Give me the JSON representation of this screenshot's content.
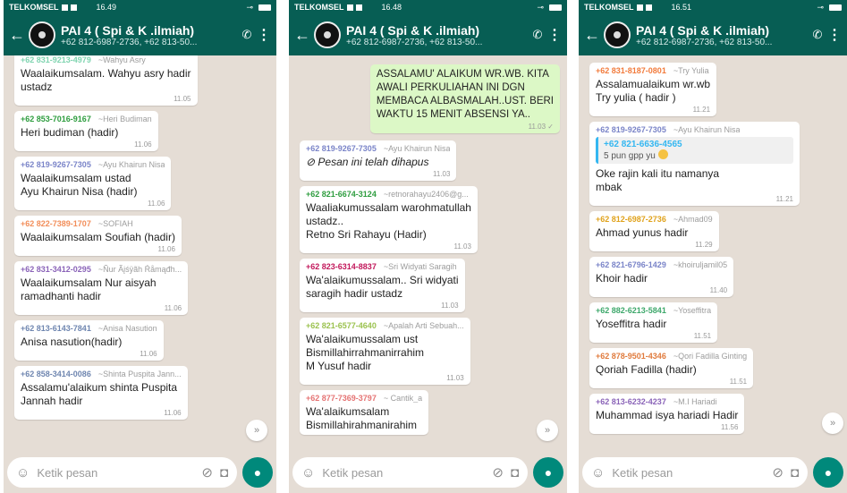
{
  "panels": [
    {
      "status": {
        "carrier": "TELKOMSEL",
        "time": "16.49"
      },
      "header": {
        "title": "PAI 4 ( Spi & K .ilmiah)",
        "subtitle": "+62 812-6987-2736, +62 813-50..."
      },
      "messages": [
        {
          "number": "+62 831-9213-4979",
          "name": "~Wahyu Asry",
          "color": "#7fd4b0",
          "text": "Waalaikumsalam. Wahyu asry hadir\nustadz",
          "time": "11.05"
        },
        {
          "number": "+62 853-7016-9167",
          "name": "~Heri Budiman",
          "color": "#2e9d3f",
          "text": "Heri budiman (hadir)",
          "time": "11.06"
        },
        {
          "number": "+62 819-9267-7305",
          "name": "~Ayu Khairun Nisa",
          "color": "#7a84c8",
          "text": "Waalaikumsalam ustad\nAyu Khairun Nisa (hadir)",
          "time": "11.06"
        },
        {
          "number": "+62 822-7389-1707",
          "name": "~SOFIAH",
          "color": "#f28e5a",
          "text": "Waalaikumsalam Soufiah (hadir)",
          "time": "11.06"
        },
        {
          "number": "+62 831-3412-0295",
          "name": "~Ñur Ãįśÿãh Ŕåmąđh...",
          "color": "#8a63b8",
          "text": "Waalaikumsalam Nur aisyah\nramadhanti hadir",
          "time": "11.06"
        },
        {
          "number": "+62 813-6143-7841",
          "name": "~Anisa Nasution",
          "color": "#6f86b0",
          "text": "Anisa nasution(hadir)",
          "time": "11.06"
        },
        {
          "number": "+62 858-3414-0086",
          "name": "~Shinta Puspita Jann...",
          "color": "#6f86b0",
          "text": "Assalamu'alaikum shinta Puspita\nJannah hadir",
          "time": "11.06"
        }
      ],
      "input": {
        "placeholder": "Ketik pesan"
      }
    },
    {
      "status": {
        "carrier": "TELKOMSEL",
        "time": "16.48"
      },
      "header": {
        "title": "PAI 4 ( Spi & K .ilmiah)",
        "subtitle": "+62 812-6987-2736, +62 813-50..."
      },
      "outgoing": {
        "text": "ASSALAMU' ALAIKUM WR.WB. KITA\nAWALI PERKULIAHAN INI DGN\nMEMBACA ALBASMALAH..UST. BERI\nWAKTU 15 MENIT ABSENSI YA..",
        "time": "11.03 ✓"
      },
      "messages": [
        {
          "number": "+62 819-9267-7305",
          "name": "~Ayu Khairun Nisa",
          "color": "#7a84c8",
          "text": "Pesan ini telah dihapus",
          "time": "11.03",
          "deleted": true
        },
        {
          "number": "+62 821-6674-3124",
          "name": "~retnorahayu2406@g...",
          "color": "#2e9d3f",
          "text": "Waaliakumussalam warohmatullah\nustadz..\nRetno Sri Rahayu (Hadir)",
          "time": "11.03"
        },
        {
          "number": "+62 823-6314-8837",
          "name": "~Sri Widyati Saragih",
          "color": "#c2185b",
          "text": "Wa'alaikumussalam.. Sri widyati\nsaragih hadir ustadz",
          "time": "11.03"
        },
        {
          "number": "+62 821-6577-4640",
          "name": "~Apalah Arti Sebuah...",
          "color": "#9bc24f",
          "text": "Wa'alaikumussalam ust\nBismillahirrahmanirrahim\nM Yusuf hadir",
          "time": "11.03"
        },
        {
          "number": "+62 877-7369-3797",
          "name": "~ Cantik_a",
          "color": "#e57373",
          "text": "Wa'alaikumsalam\nBismillahirahmanirahim",
          "time": ""
        }
      ],
      "input": {
        "placeholder": "Ketik pesan"
      }
    },
    {
      "status": {
        "carrier": "TELKOMSEL",
        "time": "16.51"
      },
      "header": {
        "title": "PAI 4 ( Spi & K .ilmiah)",
        "subtitle": "+62 812-6987-2736, +62 813-50..."
      },
      "messages": [
        {
          "number": "+62 831-8187-0801",
          "name": "~Try Yulia",
          "color": "#f27b3c",
          "text": "Assalamualaikum wr.wb\nTry yulia ( hadir )",
          "time": "11.21"
        },
        {
          "number": "+62 819-9267-7305",
          "name": "~Ayu Khairun Nisa",
          "color": "#7a84c8",
          "quote": {
            "number": "+62 821-6636-4565",
            "text": "5 pun gpp yu"
          },
          "text": "Oke rajin kali itu namanya\nmbak",
          "time": "11.21"
        },
        {
          "number": "+62 812-6987-2736",
          "name": "~Ahmad09",
          "color": "#e0a21b",
          "text": "Ahmad yunus hadir",
          "time": "11.29"
        },
        {
          "number": "+62 821-6796-1429",
          "name": "~khoiruljamil05",
          "color": "#7a84c8",
          "text": "Khoir hadir",
          "time": "11.40"
        },
        {
          "number": "+62 882-6213-5841",
          "name": "~Yoseffitra",
          "color": "#3ea86b",
          "text": "Yoseffitra hadir",
          "time": "11.51"
        },
        {
          "number": "+62 878-9501-4346",
          "name": "~Qori Fadilla Ginting",
          "color": "#e07a3c",
          "text": "Qoriah Fadilla (hadir)",
          "time": "11.51"
        },
        {
          "number": "+62 813-6232-4237",
          "name": "~M.I Hariadi",
          "color": "#8a63b8",
          "text": "Muhammad isya hariadi Hadir",
          "time": "11.56"
        }
      ],
      "input": {
        "placeholder": "Ketik pesan"
      }
    }
  ]
}
